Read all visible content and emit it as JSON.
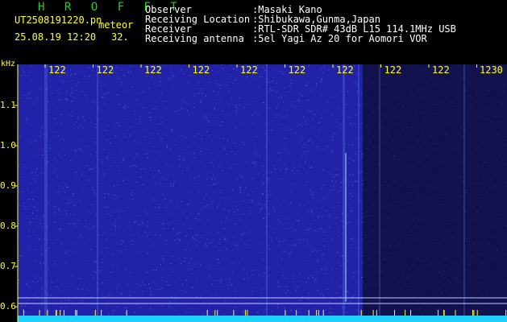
{
  "window": {
    "title": "H R O F F T",
    "file_name": "UT2508191220.pn",
    "tag": "meteor",
    "datetime": "25.08.19 12:20",
    "count": "32."
  },
  "station": {
    "observer_label": "Observer",
    "observer_value": ":Masaki Kano",
    "location_label": "Receiving Location",
    "location_value": ":Shibukawa,Gunma,Japan",
    "receiver_label": "Receiver",
    "receiver_value": ":RTL-SDR SDR# 43dB L15 114.1MHz USB",
    "antenna_label": "Receiving antenna",
    "antenna_value": ":5el Yagi Az 20 for Aomori VOR"
  },
  "chart_data": {
    "type": "heatmap",
    "ylabel": "kHz",
    "y_ticks": [
      "1.1",
      "1.0",
      "0.9",
      "0.8",
      "0.7",
      "0.6"
    ],
    "x_ticks": [
      "122",
      "122",
      "122",
      "122",
      "122",
      "122",
      "122",
      "122",
      "122",
      "1230"
    ],
    "colors": {
      "background": "#2222a8",
      "noise": "#5a80e0",
      "quiet": "#11114d",
      "baseline": "#1cd0ff",
      "marker": "#ffff30"
    }
  }
}
